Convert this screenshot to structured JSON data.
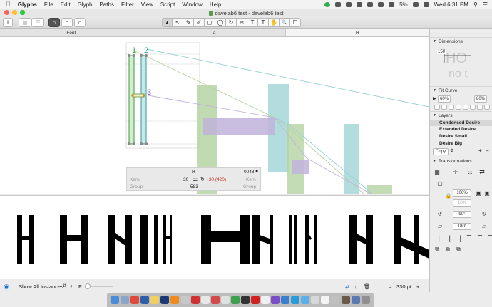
{
  "menubar": {
    "apple": "",
    "items": [
      "Glyphs",
      "File",
      "Edit",
      "Glyph",
      "Paths",
      "Filter",
      "View",
      "Script",
      "Window",
      "Help"
    ],
    "battery": "5%",
    "clock": "Wed 6:31 PM"
  },
  "window": {
    "title": "davelab6 test - davelab6 test"
  },
  "toolbar": {
    "info_label": "i",
    "glyph_buttons": [
      "∩",
      "∩",
      "∩"
    ],
    "tools": [
      "▲",
      "↖",
      "✎",
      "✐",
      "◻",
      "◯",
      "↻",
      "✂",
      "T",
      "T",
      "✋",
      "🔍",
      "☐"
    ]
  },
  "tabs": [
    "Font",
    "a",
    "H"
  ],
  "canvas": {
    "labels": [
      "1",
      "2",
      "3"
    ],
    "glyph_name": "H",
    "unicode": "0048",
    "kern_label": "Kern",
    "group_label": "Group",
    "kern_value": "30",
    "kern_adjust": "+30 (420)",
    "width": "583"
  },
  "preview": {},
  "bottom": {
    "show_instances": "Show All Instances",
    "preview_f": "F",
    "zoom": "330 pt"
  },
  "sidebar": {
    "dimensions_title": "Dimensions",
    "dimension_value": "150",
    "fitcurve_title": "Fit Curve",
    "fit_left": "60%",
    "fit_right": "80%",
    "layers_title": "Layers",
    "layers": [
      "Condensed Desire",
      "Extended Desire",
      "Desire Small",
      "Desire Big"
    ],
    "copy_label": "Copy",
    "transformations_title": "Transformations",
    "scale_value": "100%",
    "scale_value2": "10%",
    "rotate_value": "90°",
    "slant_value": "180°"
  },
  "colors": {
    "green_box": "#b5d3a3",
    "teal_box": "#98d0d3",
    "purple_box": "#c1b3da",
    "outline_green": "#3d9a3d",
    "outline_teal": "#2d9aa0",
    "purple_label": "#7b3fa5",
    "kern_red": "#c8281e"
  },
  "dock": {
    "count": 27
  }
}
